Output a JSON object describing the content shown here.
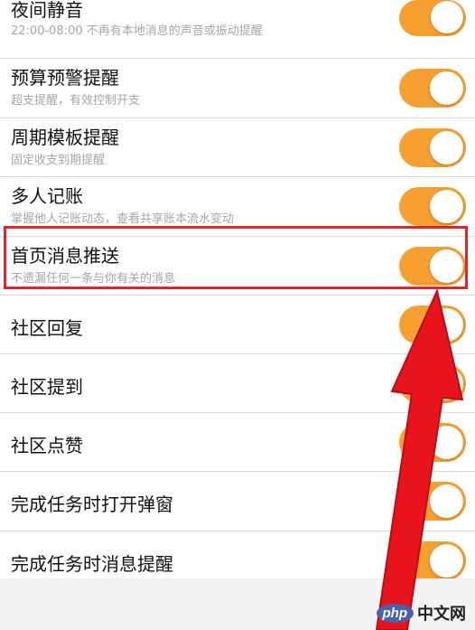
{
  "settings": [
    {
      "title": "夜间静音",
      "subtitle": "22:00-08:00 不再有本地消息的声音或振动提醒",
      "enabled": true
    },
    {
      "title": "预算预警提醒",
      "subtitle": "超支提醒，有效控制开支",
      "enabled": true
    },
    {
      "title": "周期模板提醒",
      "subtitle": "固定收支到期提醒",
      "enabled": true
    },
    {
      "title": "多人记账",
      "subtitle": "掌握他人记账动态，查看共享账本流水变动",
      "enabled": true
    },
    {
      "title": "首页消息推送",
      "subtitle": "不遗漏任何一条与你有关的消息",
      "enabled": true
    },
    {
      "title": "社区回复",
      "enabled": true
    },
    {
      "title": "社区提到",
      "enabled": true
    },
    {
      "title": "社区点赞",
      "enabled": true
    },
    {
      "title": "完成任务时打开弹窗",
      "enabled": true
    },
    {
      "title": "完成任务时消息提醒",
      "enabled": true
    }
  ],
  "watermark": {
    "badge": "php",
    "text": "中文网"
  },
  "colors": {
    "toggle_on": "#f5a030",
    "highlight": "#d9272b",
    "arrow": "#e8131b"
  }
}
